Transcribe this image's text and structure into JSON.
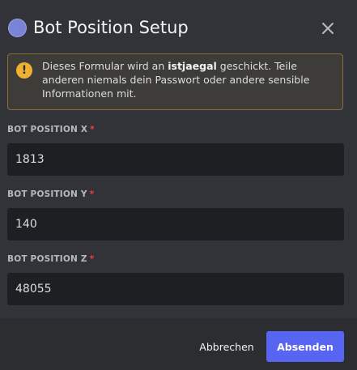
{
  "modal": {
    "title": "Bot Position Setup",
    "app_icon": "app-avatar-icon",
    "close_icon": "close-icon"
  },
  "notice": {
    "icon": "warning-icon",
    "icon_glyph": "!",
    "text_before": "Dieses Formular wird an ",
    "recipient": "istjaegal",
    "text_after": " geschickt. Teile anderen niemals dein Passwort oder andere sensible Informationen mit."
  },
  "fields": [
    {
      "label": "BOT POSITION X",
      "required_mark": "*",
      "value": "1813"
    },
    {
      "label": "BOT POSITION Y",
      "required_mark": "*",
      "value": "140"
    },
    {
      "label": "BOT POSITION Z",
      "required_mark": "*",
      "value": "48055"
    }
  ],
  "footer": {
    "cancel_label": "Abbrechen",
    "submit_label": "Absenden"
  },
  "colors": {
    "background": "#313338",
    "footer": "#2b2d31",
    "input": "#1e1f22",
    "accent": "#5865f2",
    "warning": "#f0b132",
    "required": "#f23f43"
  }
}
